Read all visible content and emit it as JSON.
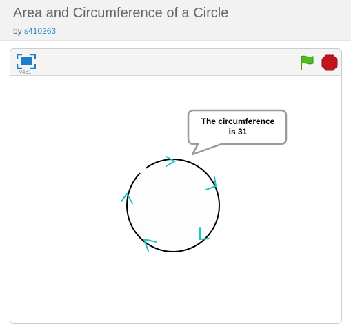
{
  "header": {
    "title": "Area and Circumference of a Circle",
    "by_label": "by",
    "author": "s410263"
  },
  "player": {
    "version": "v461",
    "icons": {
      "fullscreen": "fullscreen-icon",
      "green_flag": "green-flag-icon",
      "stop": "stop-sign-icon"
    },
    "colors": {
      "flag_green": "#4cbf1f",
      "stop_red": "#c0161b",
      "fullscreen_blue": "#1e7ec8",
      "arrow_cyan": "#1fc1c1"
    }
  },
  "stage": {
    "speech_bubble": {
      "line1": "The circumference",
      "line2": "is 31"
    }
  }
}
